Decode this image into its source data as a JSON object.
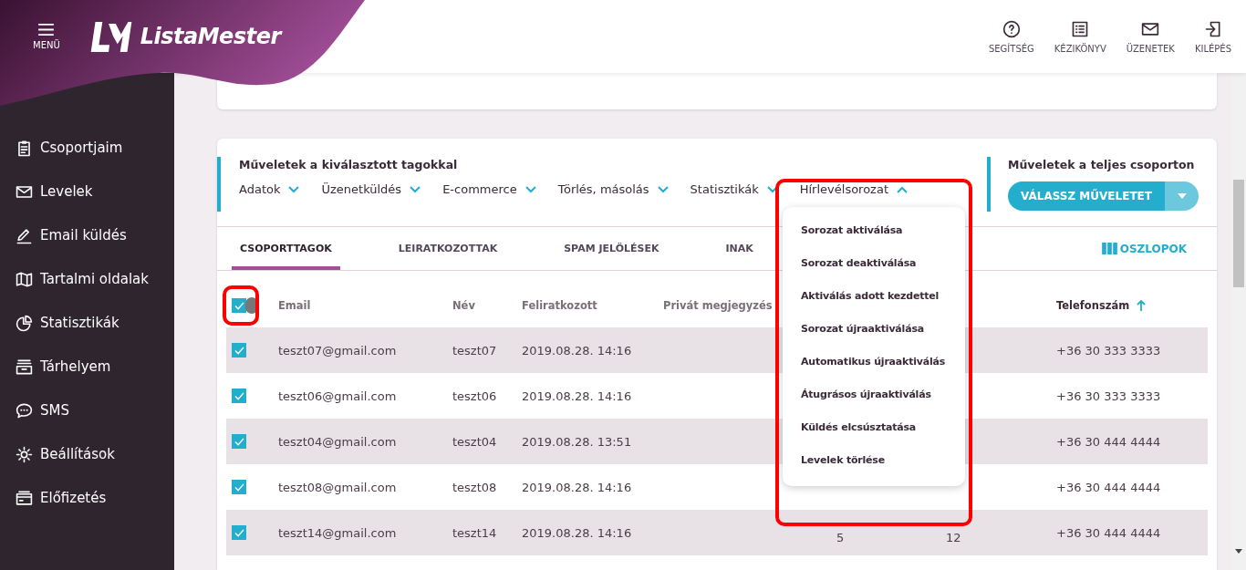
{
  "header": {
    "menu_label": "MENÜ",
    "brand": "ListaMester",
    "actions": [
      {
        "kind": "help",
        "label": "SEGÍTSÉG"
      },
      {
        "kind": "manual",
        "label": "KÉZIKÖNYV"
      },
      {
        "kind": "messages",
        "label": "ÜZENETEK"
      },
      {
        "kind": "logout",
        "label": "KILÉPÉS"
      }
    ]
  },
  "sidebar": {
    "items": [
      {
        "kind": "clipboard",
        "label": "Csoportjaim"
      },
      {
        "kind": "mail",
        "label": "Levelek"
      },
      {
        "kind": "pen",
        "label": "Email küldés"
      },
      {
        "kind": "book",
        "label": "Tartalmi oldalak"
      },
      {
        "kind": "pie",
        "label": "Statisztikák"
      },
      {
        "kind": "archive",
        "label": "Tárhelyem"
      },
      {
        "kind": "chat",
        "label": "SMS"
      },
      {
        "kind": "gear",
        "label": "Beállítások"
      },
      {
        "kind": "card",
        "label": "Előfizetés"
      }
    ]
  },
  "selected_actions": {
    "title": "Műveletek a kiválasztott tagokkal",
    "menus": [
      {
        "label": "Adatok",
        "expanded": false
      },
      {
        "label": "Üzenetküldés",
        "expanded": false
      },
      {
        "label": "E-commerce",
        "expanded": false
      },
      {
        "label": "Törlés, másolás",
        "expanded": false
      },
      {
        "label": "Statisztikák",
        "expanded": false
      },
      {
        "label": "Hírlevélsorozat",
        "expanded": true
      }
    ],
    "dropdown": {
      "highlighted": true,
      "items": [
        "Sorozat aktiválása",
        "Sorozat deaktiválása",
        "Aktiválás adott kezdettel",
        "Sorozat újraaktiválása",
        "Automatikus újraaktiválás",
        "Átugrásos újraaktiválás",
        "Küldés elcsúsztatása",
        "Levelek törlése"
      ]
    }
  },
  "group_actions": {
    "title": "Műveletek a teljes csoporton",
    "button": "VÁLASSZ MŰVELETET"
  },
  "tabs": [
    {
      "label": "CSOPORTTAGOK",
      "selected": true
    },
    {
      "label": "LEIRATKOZOTTAK",
      "selected": false
    },
    {
      "label": "SPAM JELÖLÉSEK",
      "selected": false
    },
    {
      "label": "INAK",
      "selected": false
    }
  ],
  "columns_button": "OSZLOPOK",
  "table": {
    "select_all": {
      "checked": true,
      "highlighted": true
    },
    "columns": {
      "email": {
        "label": "Email",
        "sorted": false
      },
      "name": {
        "label": "Név",
        "sorted": false
      },
      "subscribed": {
        "label": "Feliratkozott",
        "sorted": false
      },
      "note": {
        "label": "Privát megjegyzés",
        "sorted": false
      },
      "phone": {
        "label": "Telefonszám",
        "sorted": true
      }
    },
    "rows": [
      {
        "checked": true,
        "email": "teszt07@gmail.com",
        "name": "teszt07",
        "subscribed": "2019.08.28. 14:16",
        "phone": "+36 30 333 3333"
      },
      {
        "checked": true,
        "email": "teszt06@gmail.com",
        "name": "teszt06",
        "subscribed": "2019.08.28. 14:16",
        "phone": "+36 30 333 3333"
      },
      {
        "checked": true,
        "email": "teszt04@gmail.com",
        "name": "teszt04",
        "subscribed": "2019.08.28. 13:51",
        "phone": "+36 30 444 4444"
      },
      {
        "checked": true,
        "email": "teszt08@gmail.com",
        "name": "teszt08",
        "subscribed": "2019.08.28. 14:16",
        "phone": "+36 30 444 4444"
      },
      {
        "checked": true,
        "email": "teszt14@gmail.com",
        "name": "teszt14",
        "subscribed": "2019.08.28. 14:16",
        "column_6": "5",
        "column_7": "12",
        "phone": "+36 30 444 4444"
      }
    ]
  }
}
